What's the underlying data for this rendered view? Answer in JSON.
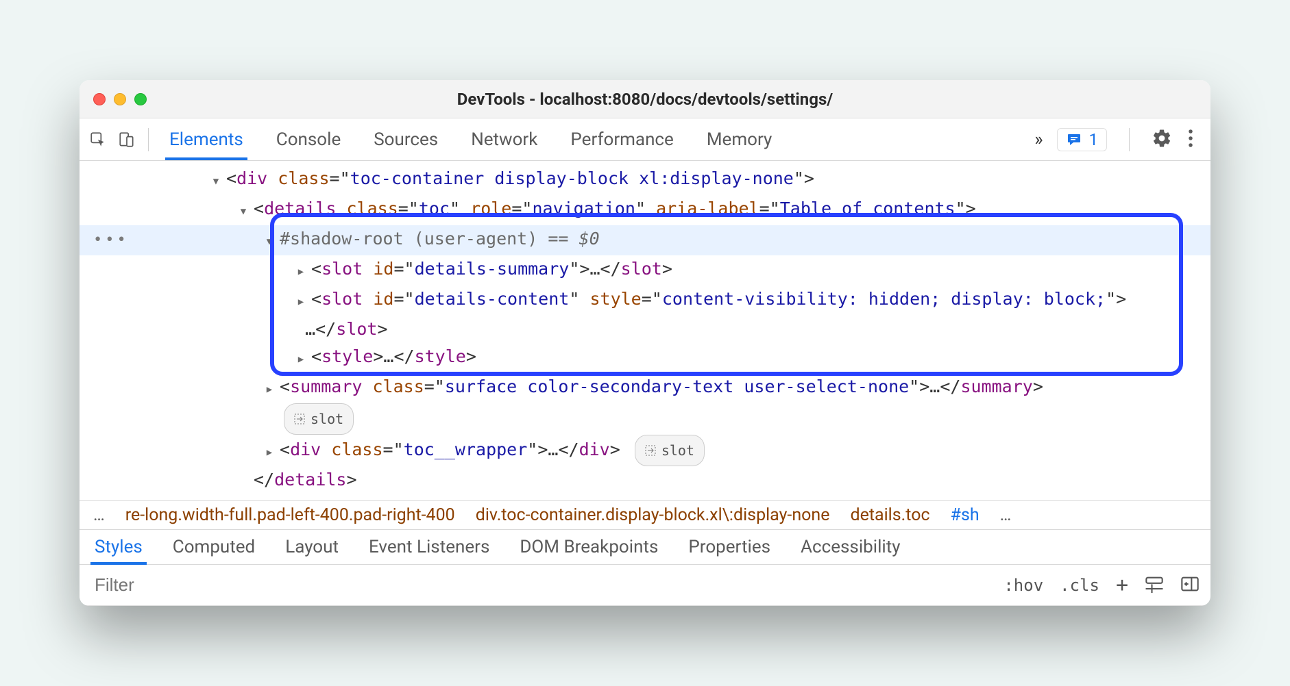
{
  "title": "DevTools - localhost:8080/docs/devtools/settings/",
  "toolbar": {
    "tabs": [
      "Elements",
      "Console",
      "Sources",
      "Network",
      "Performance",
      "Memory"
    ],
    "active_tab": 0,
    "badge_count": "1"
  },
  "dom": {
    "l1": {
      "tag": "div",
      "class": "toc-container display-block xl:display-none"
    },
    "l2": {
      "tag": "details",
      "class": "toc",
      "role": "navigation",
      "aria_label": "Table of contents"
    },
    "l3": {
      "text": "#shadow-root (user-agent)",
      "suffix": "== ",
      "var": "$0"
    },
    "l4": {
      "tag": "slot",
      "id": "details-summary",
      "ell": "…"
    },
    "l5": {
      "tag": "slot",
      "id": "details-content",
      "style": "content-visibility: hidden; display: block;",
      "ell": "…"
    },
    "l6": {
      "tag": "style",
      "ell": "…"
    },
    "l7": {
      "tag": "summary",
      "class": "surface color-secondary-text user-select-none",
      "ell": "…"
    },
    "slot_badge": "slot",
    "l8": {
      "tag": "div",
      "class": "toc__wrapper",
      "ell": "…"
    },
    "l9": {
      "close": "details"
    }
  },
  "breadcrumbs": {
    "left_ell": "…",
    "a": "re-long.width-full.pad-left-400.pad-right-400",
    "b": "div.toc-container.display-block.xl\\:display-none",
    "c": "details.toc",
    "d": "#sh",
    "right_ell": "…"
  },
  "styles_tabs": [
    "Styles",
    "Computed",
    "Layout",
    "Event Listeners",
    "DOM Breakpoints",
    "Properties",
    "Accessibility"
  ],
  "active_styles_tab": 0,
  "filter": {
    "placeholder": "Filter",
    "hov": ":hov",
    "cls": ".cls"
  }
}
